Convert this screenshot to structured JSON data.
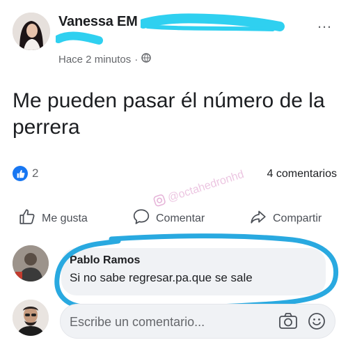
{
  "post": {
    "author": "Vanessa EM",
    "time": "Hace 2 minutos",
    "separator": "·",
    "text": "Me pueden pasar él número de la perrera",
    "more_icon": "…"
  },
  "stats": {
    "likes": "2",
    "comments": "4 comentarios"
  },
  "actions": {
    "like": "Me gusta",
    "comment": "Comentar",
    "share": "Compartir"
  },
  "watermark": "@octahedronhd",
  "comment": {
    "author": "Pablo Ramos",
    "text": "Si no sabe regresar.pa.que se sale"
  },
  "composer": {
    "placeholder": "Escribe un comentario..."
  },
  "colors": {
    "like_blue": "#1877f2",
    "highlight": "#29a9e0",
    "scribble": "#2fd0f0"
  },
  "icons": [
    "globe-icon",
    "more-icon",
    "like-badge-icon",
    "thumbs-up-icon",
    "comment-icon",
    "share-icon",
    "camera-icon",
    "emoji-icon",
    "instagram-icon"
  ]
}
